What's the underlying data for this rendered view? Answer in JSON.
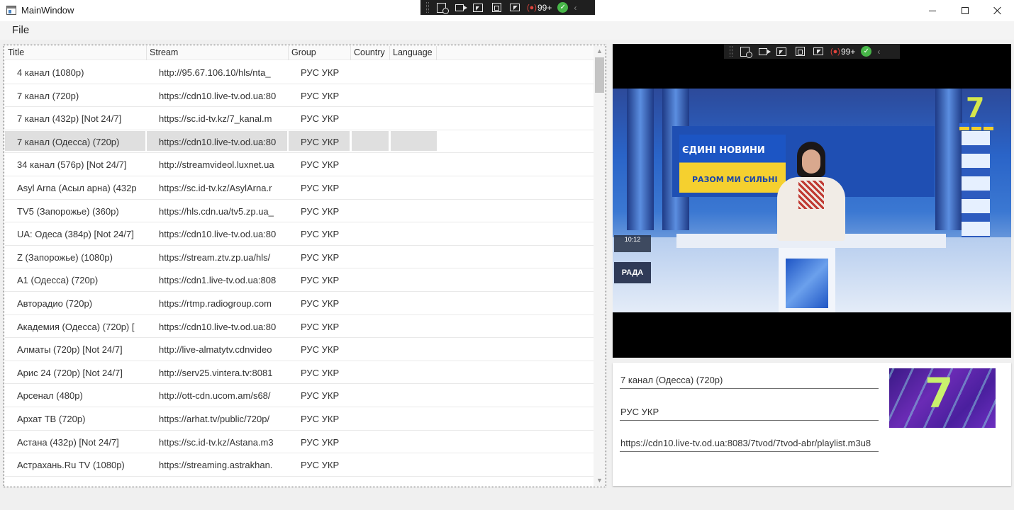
{
  "window": {
    "title": "MainWindow"
  },
  "menu": {
    "file_label": "File"
  },
  "capture_toolbar": {
    "badge_count": "99+",
    "rec_symbol": "(●)",
    "check_symbol": "✓",
    "collapse_symbol": "‹"
  },
  "grid": {
    "columns": [
      "Title",
      "Stream",
      "Group",
      "Country",
      "Language"
    ],
    "selected_index": 3,
    "rows": [
      {
        "title": "4 канал (1080p)",
        "stream": "http://95.67.106.10/hls/nta_",
        "group": "РУС УКР"
      },
      {
        "title": "7 канал (720p)",
        "stream": "https://cdn10.live-tv.od.ua:80",
        "group": "РУС УКР"
      },
      {
        "title": "7 канал (432p) [Not 24/7]",
        "stream": "https://sc.id-tv.kz/7_kanal.m",
        "group": "РУС УКР"
      },
      {
        "title": "7 канал (Одесса) (720p)",
        "stream": "https://cdn10.live-tv.od.ua:80",
        "group": "РУС УКР"
      },
      {
        "title": "34 канал (576p) [Not 24/7]",
        "stream": "http://streamvideol.luxnet.ua",
        "group": "РУС УКР"
      },
      {
        "title": "Asyl Arna (Асыл арна) (432p",
        "stream": "https://sc.id-tv.kz/AsylArna.r",
        "group": "РУС УКР"
      },
      {
        "title": "TV5 (Запорожье) (360p)",
        "stream": "https://hls.cdn.ua/tv5.zp.ua_",
        "group": "РУС УКР"
      },
      {
        "title": "UA: Одеса (384p) [Not 24/7]",
        "stream": "https://cdn10.live-tv.od.ua:80",
        "group": "РУС УКР"
      },
      {
        "title": "Z (Запорожье) (1080p)",
        "stream": "https://stream.ztv.zp.ua/hls/",
        "group": "РУС УКР"
      },
      {
        "title": "А1 (Одесса) (720p)",
        "stream": "https://cdn1.live-tv.od.ua:808",
        "group": "РУС УКР"
      },
      {
        "title": "Авторадио (720p)",
        "stream": "https://rtmp.radiogroup.com",
        "group": "РУС УКР"
      },
      {
        "title": "Академия (Одесса) (720p) [",
        "stream": "https://cdn10.live-tv.od.ua:80",
        "group": "РУС УКР"
      },
      {
        "title": "Алматы (720p) [Not 24/7]",
        "stream": "http://live-almatytv.cdnvideo",
        "group": "РУС УКР"
      },
      {
        "title": "Арис 24 (720p) [Not 24/7]",
        "stream": "http://serv25.vintera.tv:8081",
        "group": "РУС УКР"
      },
      {
        "title": "Арсенал (480p)",
        "stream": "http://ott-cdn.ucom.am/s68/",
        "group": "РУС УКР"
      },
      {
        "title": "Архат ТВ (720p)",
        "stream": "https://arhat.tv/public/720p/",
        "group": "РУС УКР"
      },
      {
        "title": "Астана (432p) [Not 24/7]",
        "stream": "https://sc.id-tv.kz/Astana.m3",
        "group": "РУС УКР"
      },
      {
        "title": "Астрахань.Ru TV (1080p)",
        "stream": "https://streaming.astrakhan.",
        "group": "РУС УКР"
      }
    ]
  },
  "video": {
    "sign_line1": "ЄДИНІ НОВИНИ",
    "sign_line2": "РАЗОМ МИ СИЛЬНІ",
    "clock_time": "10:12",
    "channel_tag": "РАДА",
    "logo_text": "7"
  },
  "details": {
    "name": "7 канал (Одесса) (720p)",
    "group": "РУС УКР",
    "url": "https://cdn10.live-tv.od.ua:8083/7tvod/7tvod-abr/playlist.m3u8",
    "thumbnail_text": "7"
  }
}
